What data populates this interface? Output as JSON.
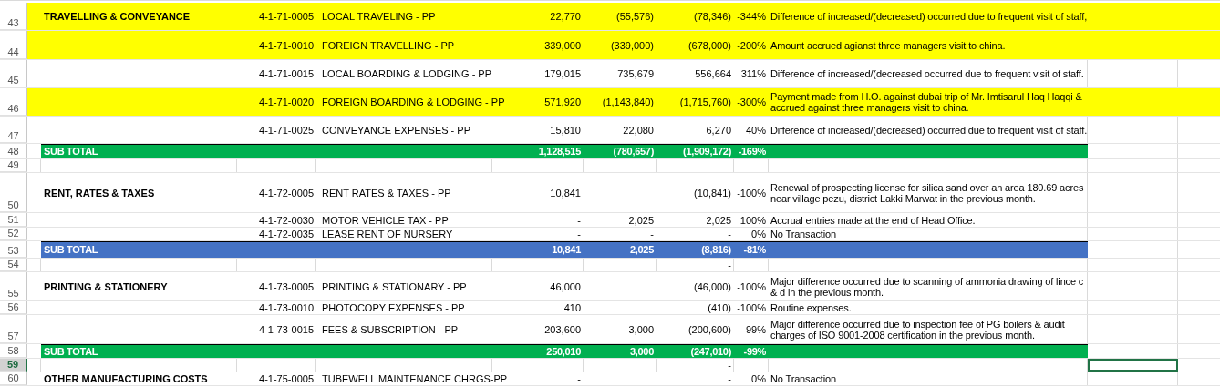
{
  "sheet": {
    "rows": [
      {
        "number": "43",
        "kind": "item",
        "highlighted": true,
        "selected": false,
        "category": "TRAVELLING & CONVEYANCE",
        "code": "4-1-71-0005",
        "description": "LOCAL TRAVELING - PP",
        "current": "22,770",
        "previous": "(55,576)",
        "difference": "(78,346)",
        "percent": "-344%",
        "remark": "Difference of increased/(decreased) occurred due to frequent visit of staff,"
      },
      {
        "number": "44",
        "kind": "item",
        "highlighted": true,
        "selected": false,
        "code": "4-1-71-0010",
        "description": "FOREIGN TRAVELLING - PP",
        "current": "339,000",
        "previous": "(339,000)",
        "difference": "(678,000)",
        "percent": "-200%",
        "remark": "Amount accrued agianst three managers visit to china."
      },
      {
        "number": "45",
        "kind": "item",
        "highlighted": false,
        "selected": false,
        "code": "4-1-71-0015",
        "description": "LOCAL BOARDING & LODGING - PP",
        "current": "179,015",
        "previous": "735,679",
        "difference": "556,664",
        "percent": "311%",
        "remark": "Difference of increased/(decreased occurred due to frequent visit of staff."
      },
      {
        "number": "46",
        "kind": "item",
        "highlighted": true,
        "selected": false,
        "code": "4-1-71-0020",
        "description": "FOREIGN BOARDING & LODGING - PP",
        "current": "571,920",
        "previous": "(1,143,840)",
        "difference": "(1,715,760)",
        "percent": "-300%",
        "remark": "Payment made from H.O. against dubai trip of Mr. Imtisarul Haq Haqqi & accrued against three managers visit to china."
      },
      {
        "number": "47",
        "kind": "item",
        "highlighted": false,
        "selected": false,
        "code": "4-1-71-0025",
        "description": "CONVEYANCE EXPENSES - PP",
        "current": "15,810",
        "previous": "22,080",
        "difference": "6,270",
        "percent": "40%",
        "remark": "Difference of increased/(decreased) occurred due to frequent visit of staff."
      },
      {
        "number": "48",
        "kind": "subtotal",
        "color": "#00b050",
        "selected": false,
        "category": "SUB TOTAL",
        "current": "1,128,515",
        "previous": "(780,657)",
        "difference": "(1,909,172)",
        "percent": "-169%"
      },
      {
        "number": "49",
        "kind": "blank",
        "selected": false
      },
      {
        "number": "50",
        "kind": "item",
        "highlighted": false,
        "selected": false,
        "category": "RENT, RATES & TAXES",
        "code": "4-1-72-0005",
        "description": "RENT RATES & TAXES - PP",
        "current": "10,841",
        "difference": "(10,841)",
        "percent": "-100%",
        "remark": "Renewal of prospecting license for silica sand over an area 180.69 acres near village pezu, district Lakki Marwat in the previous month."
      },
      {
        "number": "51",
        "kind": "item",
        "highlighted": false,
        "selected": false,
        "code": "4-1-72-0030",
        "description": "MOTOR VEHICLE TAX - PP",
        "current": "-",
        "previous": "2,025",
        "difference": "2,025",
        "percent": "100%",
        "remark": "Accrual entries made at the end of Head Office."
      },
      {
        "number": "52",
        "kind": "item",
        "highlighted": false,
        "selected": false,
        "code": "4-1-72-0035",
        "description": "LEASE RENT OF NURSERY",
        "current": "-",
        "previous": "-",
        "difference": "-",
        "percent": "0%",
        "remark": "No Transaction"
      },
      {
        "number": "53",
        "kind": "subtotal",
        "color": "#4472c4",
        "selected": false,
        "category": "SUB TOTAL",
        "current": "10,841",
        "previous": "2,025",
        "difference": "(8,816)",
        "percent": "-81%"
      },
      {
        "number": "54",
        "kind": "blank",
        "selected": false,
        "difference": "-"
      },
      {
        "number": "55",
        "kind": "item",
        "highlighted": false,
        "selected": false,
        "category": "PRINTING & STATIONERY",
        "code": "4-1-73-0005",
        "description": "PRINTING & STATIONARY - PP",
        "current": "46,000",
        "difference": "(46,000)",
        "percent": "-100%",
        "remark": "Major difference occurred due to scanning of ammonia drawing of lince c & d in the previous month."
      },
      {
        "number": "56",
        "kind": "item",
        "highlighted": false,
        "selected": false,
        "code": "4-1-73-0010",
        "description": "PHOTOCOPY EXPENSES - PP",
        "current": "410",
        "difference": "(410)",
        "percent": "-100%",
        "remark": "Routine expenses."
      },
      {
        "number": "57",
        "kind": "item",
        "highlighted": false,
        "selected": false,
        "code": "4-1-73-0015",
        "description": "FEES & SUBSCRIPTION - PP",
        "current": "203,600",
        "previous": "3,000",
        "difference": "(200,600)",
        "percent": "-99%",
        "remark": "Major difference occurred due to inspection fee of PG boilers & audit charges of ISO 9001-2008 certification in the previous month."
      },
      {
        "number": "58",
        "kind": "subtotal",
        "color": "#00b050",
        "selected": false,
        "category": "SUB TOTAL",
        "current": "250,010",
        "previous": "3,000",
        "difference": "(247,010)",
        "percent": "-99%"
      },
      {
        "number": "59",
        "kind": "blank",
        "selected": true,
        "difference": "-"
      },
      {
        "number": "60",
        "kind": "item",
        "highlighted": false,
        "selected": false,
        "category": "OTHER MANUFACTURING COSTS",
        "code": "4-1-75-0005",
        "description": "TUBEWELL MAINTENANCE CHRGS-PP",
        "current": "-",
        "difference": "-",
        "percent": "0%",
        "remark": "No Transaction"
      }
    ]
  }
}
